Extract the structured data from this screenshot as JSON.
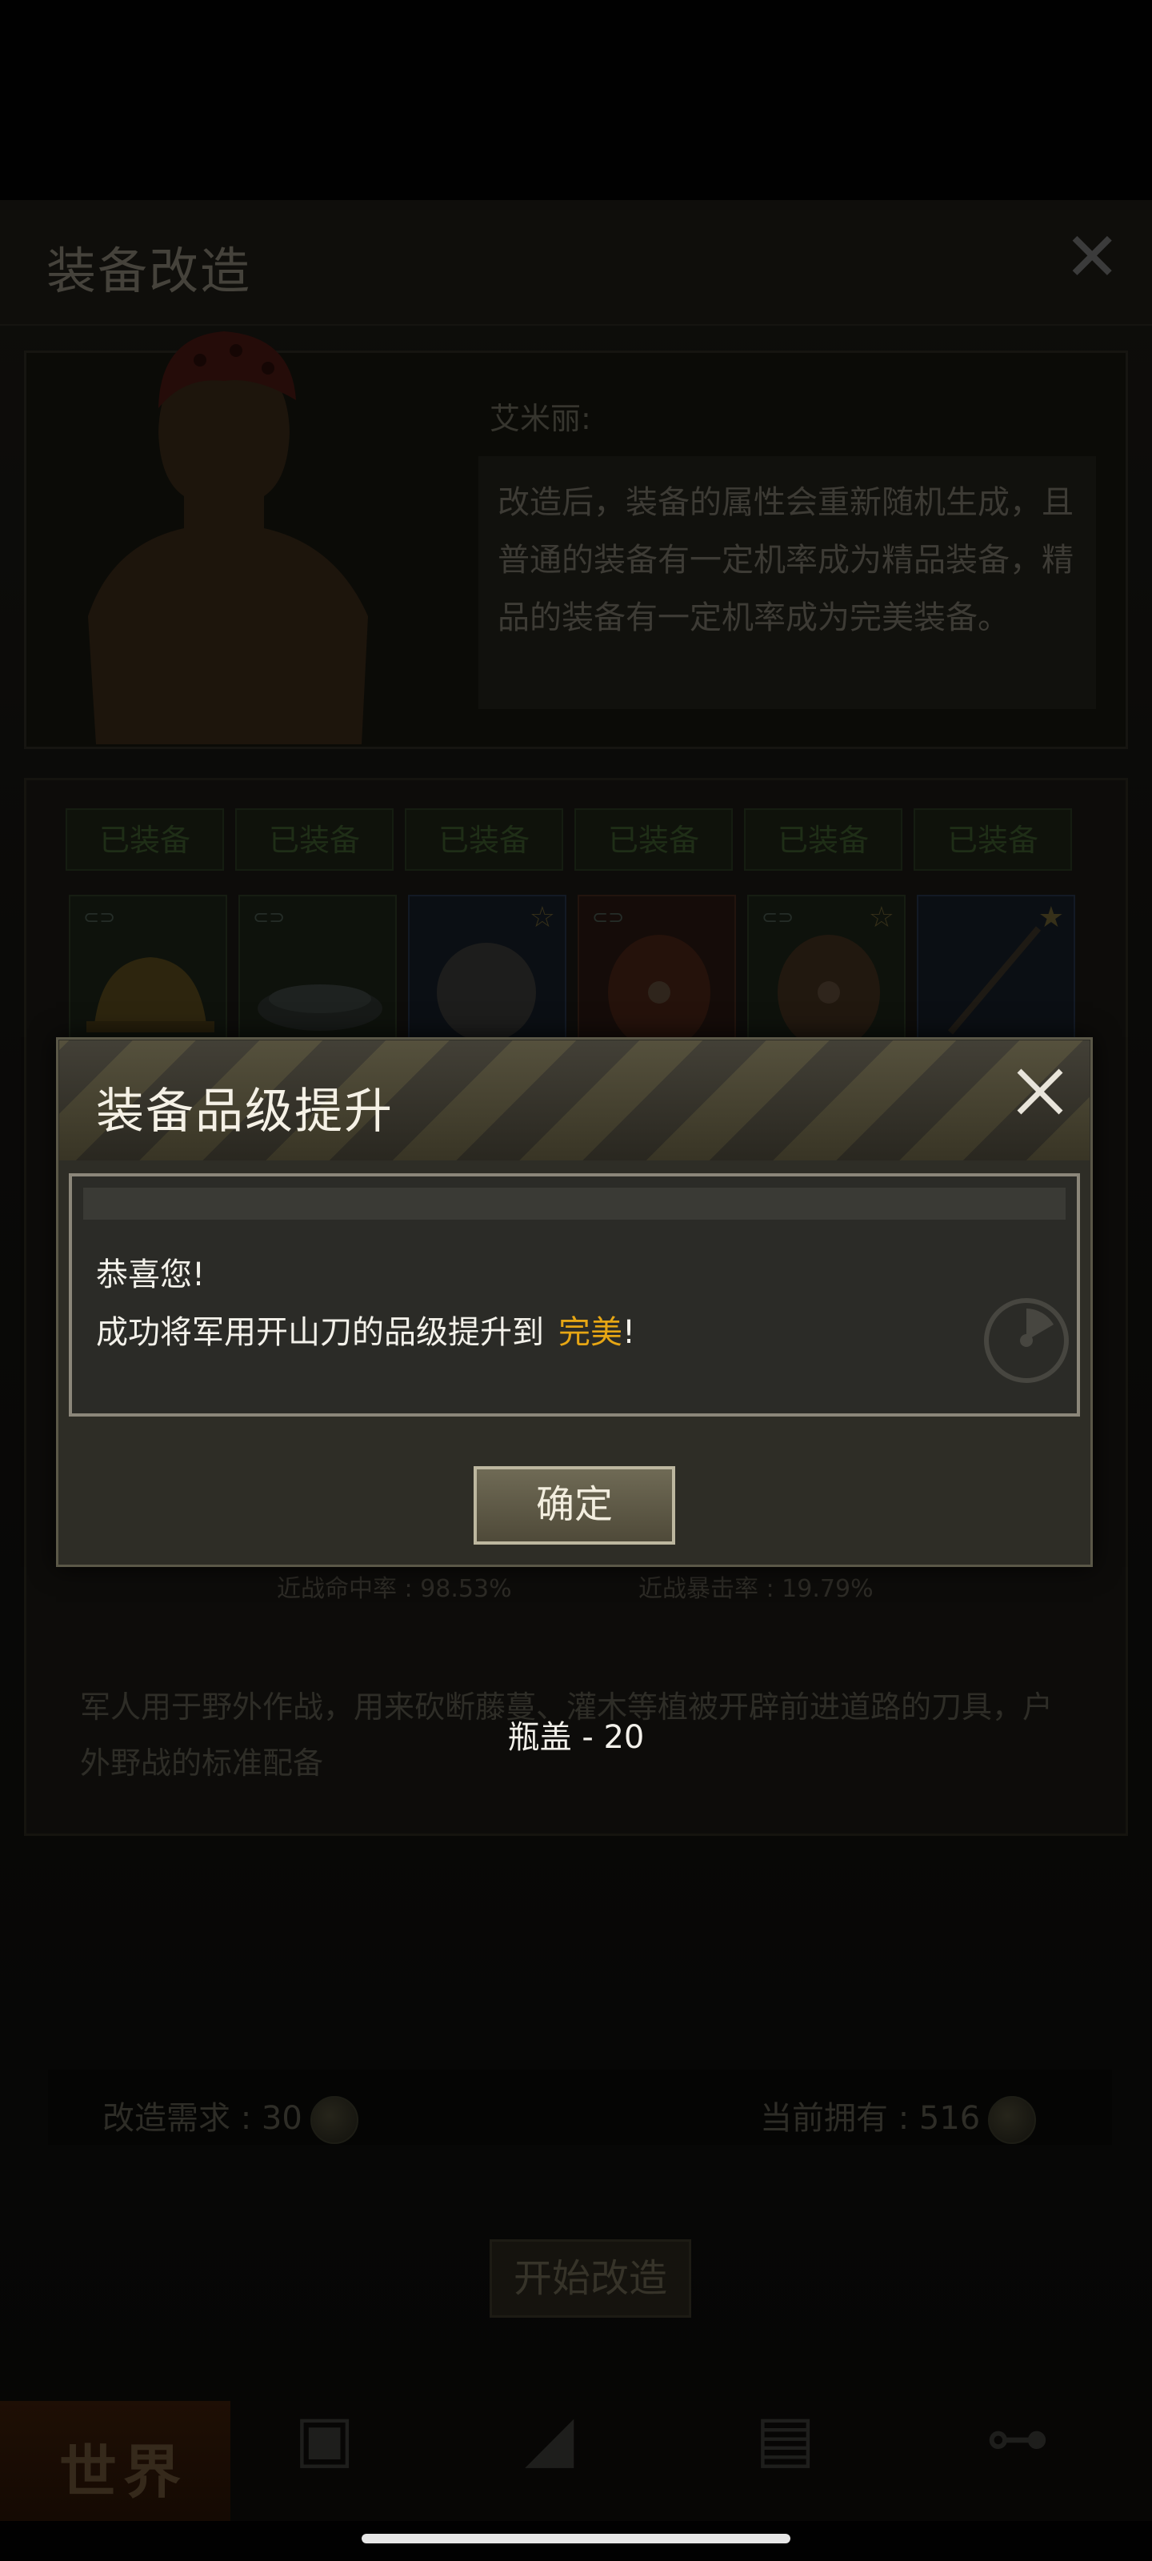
{
  "background_screen": {
    "title": "装备改造",
    "npc": {
      "name": "艾米丽:",
      "speech": "改造后，装备的属性会重新随机生成，且普通的装备有一定机率成为精品装备，精品的装备有一定机率成为完美装备。"
    },
    "equipped_tags": [
      "已装备",
      "已装备",
      "已装备",
      "已装备",
      "已装备",
      "已装备"
    ],
    "items": [
      {
        "icon": "hard-hat-icon",
        "color": "green"
      },
      {
        "icon": "pot-icon",
        "color": "green"
      },
      {
        "icon": "round-shield-icon",
        "color": "blue"
      },
      {
        "icon": "wood-shield-icon",
        "color": "red"
      },
      {
        "icon": "wood-shield-icon",
        "color": "green"
      },
      {
        "icon": "magic-wand-icon",
        "color": "blue"
      }
    ],
    "stats": {
      "left": "近战命中率 : 98.53%",
      "right": "近战暴击率 : 19.79%"
    },
    "description": "军人用于野外作战，用来砍断藤蔓、灌木等植被开辟前进道路的刀具，户外野战的标准配备",
    "requirement": "改造需求 : 30",
    "owned": "当前拥有 : 516",
    "start_button": "开始改造",
    "nav": {
      "world_label": "世界"
    }
  },
  "toast": "瓶盖 - 20",
  "modal": {
    "title": "装备品级提升",
    "line1": "恭喜您!",
    "line2_prefix": "成功将军用开山刀的品级提升到",
    "line2_highlight": "完美",
    "line2_suffix": "!",
    "confirm": "确定"
  },
  "colors": {
    "highlight": "#e6a614",
    "stripe_dark": "#37342a",
    "stripe_light": "#4b4631"
  }
}
